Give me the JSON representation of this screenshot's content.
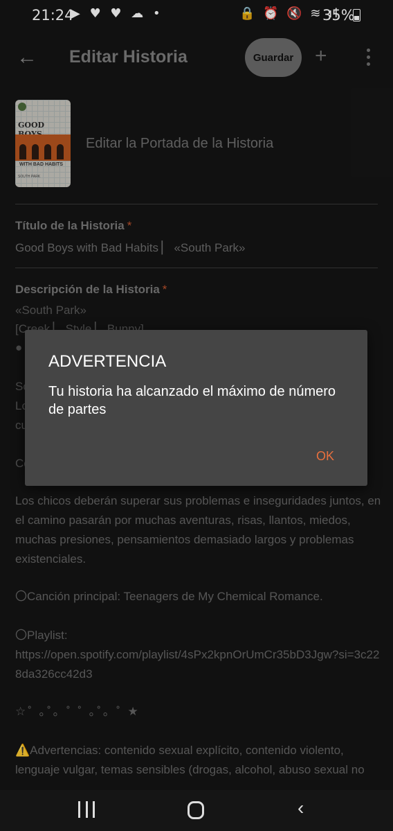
{
  "status_bar": {
    "time": "21:24",
    "left_icons": "▶ ♥ ♥ ☁ •",
    "right_icons": "🔒 ⏰ 🔇 ≋ ıl",
    "battery": "35%"
  },
  "app_bar": {
    "back_icon": "←",
    "title": "Editar Historia",
    "save_label": "Guardar",
    "add_icon": "+",
    "more_icon": "more-vertical-icon"
  },
  "cover": {
    "title_text": "GOOD BOYS",
    "subtitle_text": "WITH BAD HABITS",
    "footer_text": "SOUTH PARK",
    "edit_label": "Editar la Portada de la Historia"
  },
  "story_title": {
    "label": "Título de la Historia",
    "required_mark": "*",
    "value": "Good Boys with Bad Habits ▏ «South Park»"
  },
  "description": {
    "label": "Descripción de la Historia",
    "required_mark": "*",
    "line1": "«South Park»",
    "line2": "[Creek ▏ Style ▏ Bunny]",
    "line3_fragment": "●",
    "line4_fragment": "So",
    "line5_fragment": "Lo",
    "line6_fragment": "cu",
    "line7_fragment": "Co",
    "paragraph": "Los chicos deberán superar sus problemas e inseguridades juntos, en el camino pasarán por muchas aventuras, risas, llantos, miedos, muchas presiones, pensamientos demasiado largos y problemas existenciales.",
    "song": "〇Canción principal: Teenagers de My Chemical Romance.",
    "playlist_label": "〇Playlist:",
    "playlist_url": "https://open.spotify.com/playlist/4sPx2kpnOrUmCr35bD3Jgw?si=3c228da326cc42d3",
    "decor": "☆˚ ｡˚｡ ˚ ˚ ｡˚｡ ˚ ★",
    "warnings": "⚠️Advertencias: contenido sexual explícito, contenido violento, lenguaje vulgar, temas sensibles (drogas, alcohol, abuso sexual no"
  },
  "dialog": {
    "title": "ADVERTENCIA",
    "message": "Tu historia ha alcanzado el máximo de número de partes",
    "ok_label": "OK"
  },
  "colors": {
    "background": "#151515",
    "accent": "#e8703e",
    "dialog_bg": "#454545"
  }
}
